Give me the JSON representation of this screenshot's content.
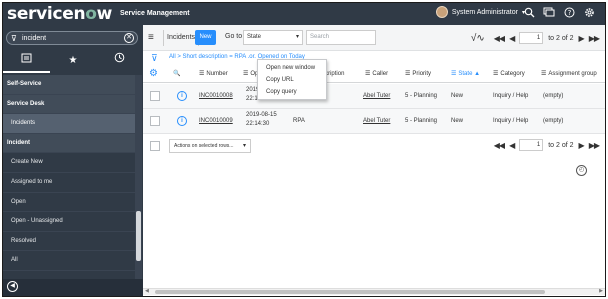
{
  "banner": {
    "logo_text_a": "servicen",
    "logo_text_o": "o",
    "logo_text_b": "w",
    "app_title": "Service Management",
    "user_name": "System Administrator",
    "user_caret": "▾",
    "icons": [
      "search-icon",
      "chat-icon",
      "help-icon",
      "gear-icon"
    ]
  },
  "navigator": {
    "filter_value": "incident",
    "tabs": [
      "all-apps-icon",
      "favorites-icon",
      "history-icon"
    ],
    "items": [
      {
        "label": "Self-Service",
        "kind": "section"
      },
      {
        "label": "Service Desk",
        "kind": "section"
      },
      {
        "label": "Incidents",
        "kind": "selected"
      },
      {
        "label": "Incident",
        "kind": "section"
      },
      {
        "label": "Create New",
        "kind": "module"
      },
      {
        "label": "Assigned to me",
        "kind": "module"
      },
      {
        "label": "Open",
        "kind": "module"
      },
      {
        "label": "Open - Unassigned",
        "kind": "module"
      },
      {
        "label": "Resolved",
        "kind": "module"
      },
      {
        "label": "All",
        "kind": "module"
      }
    ]
  },
  "toolbar": {
    "list_title": "Incidents",
    "new_label": "New",
    "goto_label": "Go to",
    "goto_value": "State",
    "search_placeholder": "Search",
    "page_value": "1",
    "page_total": "to 2 of 2"
  },
  "breadcrumb": "All > Short description = RPA .or. Opened on Today",
  "columns": {
    "number": "Number",
    "opened": "Opened",
    "description": "Short description",
    "caller": "Caller",
    "priority": "Priority",
    "state": "State",
    "category": "Category",
    "assignment": "Assignment group"
  },
  "rows": [
    {
      "number": "INC0010008",
      "opened_date": "2019-08-15",
      "opened_time": "22:1?:??",
      "description": "",
      "caller": "Abel Tuter",
      "priority": "5 - Planning",
      "state": "New",
      "category": "Inquiry / Help",
      "assignment": "(empty)"
    },
    {
      "number": "INC0010009",
      "opened_date": "2019-08-15",
      "opened_time": "22:14:30",
      "description": "RPA",
      "caller": "Abel Tuter",
      "priority": "5 - Planning",
      "state": "New",
      "category": "Inquiry / Help",
      "assignment": "(empty)"
    }
  ],
  "footer": {
    "actions_label": "Actions on selected rows...",
    "page_value": "1",
    "page_total": "to 2 of 2"
  },
  "context_menu": [
    "Open new window",
    "Copy URL",
    "Copy query"
  ],
  "colors": {
    "banner": "#303a46",
    "accent": "#278efc",
    "logo_accent": "#81b5a1"
  }
}
